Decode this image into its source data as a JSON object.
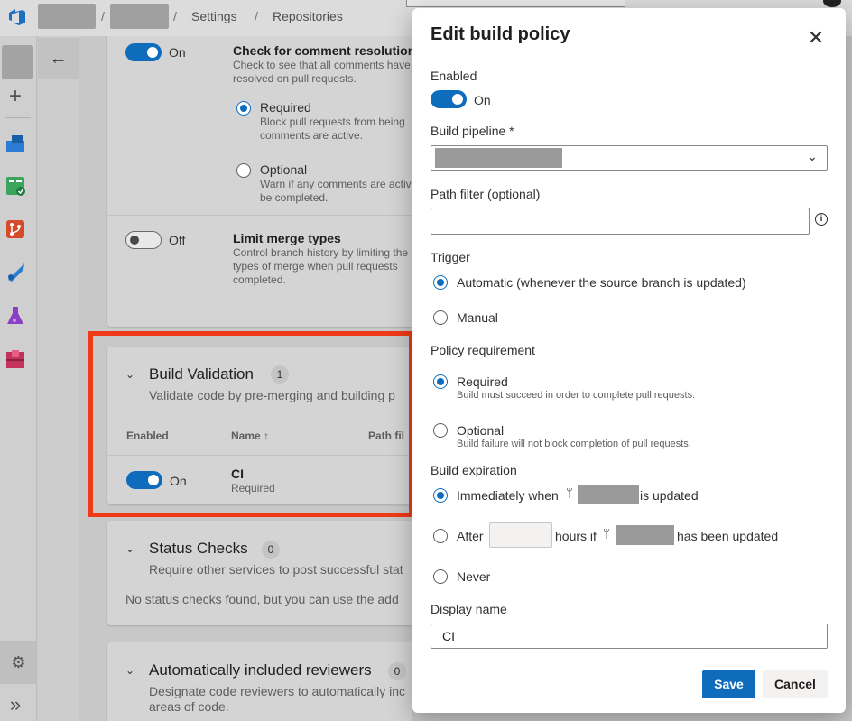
{
  "breadcrumb": {
    "settings": "Settings",
    "repositories": "Repositories",
    "sep": "/"
  },
  "main": {
    "comment_resolution": {
      "toggle_label": "On",
      "title": "Check for comment resolution",
      "desc": "Check to see that all comments have\nresolved on pull requests.",
      "required_label": "Required",
      "required_desc": "Block pull requests from being\ncomments are active.",
      "optional_label": "Optional",
      "optional_desc": "Warn if any comments are active\nbe completed."
    },
    "merge_types": {
      "toggle_label": "Off",
      "title": "Limit merge types",
      "desc": "Control branch history by limiting the\ntypes of merge when pull requests\ncompleted."
    },
    "build_validation": {
      "title": "Build Validation",
      "count": "1",
      "desc": "Validate code by pre-merging and building p",
      "col_enabled": "Enabled",
      "col_name": "Name ↑",
      "col_path": "Path fil",
      "row_toggle_label": "On",
      "row_name": "CI",
      "row_status": "Required"
    },
    "status_checks": {
      "title": "Status Checks",
      "count": "0",
      "desc": "Require other services to post successful stat",
      "empty": "No status checks found, but you can use the add"
    },
    "reviewers": {
      "title": "Automatically included reviewers",
      "count": "0",
      "desc": "Designate code reviewers to automatically inc",
      "desc2": "areas of code."
    }
  },
  "panel": {
    "title": "Edit build policy",
    "enabled_label": "Enabled",
    "enabled_toggle_label": "On",
    "pipeline_label": "Build pipeline *",
    "path_filter_label": "Path filter (optional)",
    "path_filter_value": "",
    "trigger_label": "Trigger",
    "trigger_automatic": "Automatic (whenever the source branch is updated)",
    "trigger_manual": "Manual",
    "requirement_label": "Policy requirement",
    "req_required": "Required",
    "req_required_desc": "Build must succeed in order to complete pull requests.",
    "req_optional": "Optional",
    "req_optional_desc": "Build failure will not block completion of pull requests.",
    "expiration_label": "Build expiration",
    "exp_immediately": "Immediately when",
    "exp_immediately_suffix": "is updated",
    "exp_after": "After",
    "exp_after_mid": "hours if",
    "exp_after_suffix": "has been updated",
    "exp_never": "Never",
    "display_name_label": "Display name",
    "display_name_value": "CI",
    "save_label": "Save",
    "cancel_label": "Cancel",
    "info_glyph": "i"
  },
  "colors": {
    "accent": "#0f6cbd",
    "highlight": "#f03a17"
  }
}
